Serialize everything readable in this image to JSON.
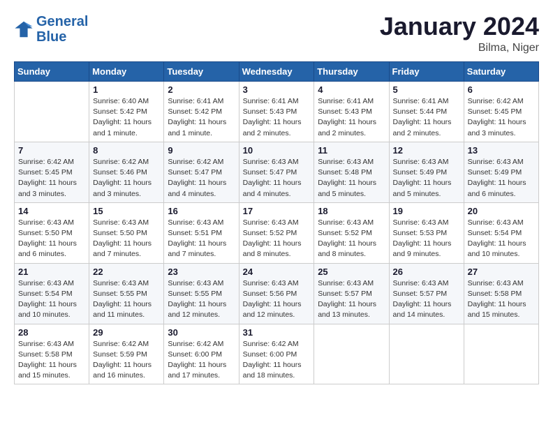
{
  "header": {
    "logo_line1": "General",
    "logo_line2": "Blue",
    "title": "January 2024",
    "subtitle": "Bilma, Niger"
  },
  "weekdays": [
    "Sunday",
    "Monday",
    "Tuesday",
    "Wednesday",
    "Thursday",
    "Friday",
    "Saturday"
  ],
  "weeks": [
    [
      {
        "day": "",
        "info": ""
      },
      {
        "day": "1",
        "info": "Sunrise: 6:40 AM\nSunset: 5:42 PM\nDaylight: 11 hours\nand 1 minute."
      },
      {
        "day": "2",
        "info": "Sunrise: 6:41 AM\nSunset: 5:42 PM\nDaylight: 11 hours\nand 1 minute."
      },
      {
        "day": "3",
        "info": "Sunrise: 6:41 AM\nSunset: 5:43 PM\nDaylight: 11 hours\nand 2 minutes."
      },
      {
        "day": "4",
        "info": "Sunrise: 6:41 AM\nSunset: 5:43 PM\nDaylight: 11 hours\nand 2 minutes."
      },
      {
        "day": "5",
        "info": "Sunrise: 6:41 AM\nSunset: 5:44 PM\nDaylight: 11 hours\nand 2 minutes."
      },
      {
        "day": "6",
        "info": "Sunrise: 6:42 AM\nSunset: 5:45 PM\nDaylight: 11 hours\nand 3 minutes."
      }
    ],
    [
      {
        "day": "7",
        "info": "Sunrise: 6:42 AM\nSunset: 5:45 PM\nDaylight: 11 hours\nand 3 minutes."
      },
      {
        "day": "8",
        "info": "Sunrise: 6:42 AM\nSunset: 5:46 PM\nDaylight: 11 hours\nand 3 minutes."
      },
      {
        "day": "9",
        "info": "Sunrise: 6:42 AM\nSunset: 5:47 PM\nDaylight: 11 hours\nand 4 minutes."
      },
      {
        "day": "10",
        "info": "Sunrise: 6:43 AM\nSunset: 5:47 PM\nDaylight: 11 hours\nand 4 minutes."
      },
      {
        "day": "11",
        "info": "Sunrise: 6:43 AM\nSunset: 5:48 PM\nDaylight: 11 hours\nand 5 minutes."
      },
      {
        "day": "12",
        "info": "Sunrise: 6:43 AM\nSunset: 5:49 PM\nDaylight: 11 hours\nand 5 minutes."
      },
      {
        "day": "13",
        "info": "Sunrise: 6:43 AM\nSunset: 5:49 PM\nDaylight: 11 hours\nand 6 minutes."
      }
    ],
    [
      {
        "day": "14",
        "info": "Sunrise: 6:43 AM\nSunset: 5:50 PM\nDaylight: 11 hours\nand 6 minutes."
      },
      {
        "day": "15",
        "info": "Sunrise: 6:43 AM\nSunset: 5:50 PM\nDaylight: 11 hours\nand 7 minutes."
      },
      {
        "day": "16",
        "info": "Sunrise: 6:43 AM\nSunset: 5:51 PM\nDaylight: 11 hours\nand 7 minutes."
      },
      {
        "day": "17",
        "info": "Sunrise: 6:43 AM\nSunset: 5:52 PM\nDaylight: 11 hours\nand 8 minutes."
      },
      {
        "day": "18",
        "info": "Sunrise: 6:43 AM\nSunset: 5:52 PM\nDaylight: 11 hours\nand 8 minutes."
      },
      {
        "day": "19",
        "info": "Sunrise: 6:43 AM\nSunset: 5:53 PM\nDaylight: 11 hours\nand 9 minutes."
      },
      {
        "day": "20",
        "info": "Sunrise: 6:43 AM\nSunset: 5:54 PM\nDaylight: 11 hours\nand 10 minutes."
      }
    ],
    [
      {
        "day": "21",
        "info": "Sunrise: 6:43 AM\nSunset: 5:54 PM\nDaylight: 11 hours\nand 10 minutes."
      },
      {
        "day": "22",
        "info": "Sunrise: 6:43 AM\nSunset: 5:55 PM\nDaylight: 11 hours\nand 11 minutes."
      },
      {
        "day": "23",
        "info": "Sunrise: 6:43 AM\nSunset: 5:55 PM\nDaylight: 11 hours\nand 12 minutes."
      },
      {
        "day": "24",
        "info": "Sunrise: 6:43 AM\nSunset: 5:56 PM\nDaylight: 11 hours\nand 12 minutes."
      },
      {
        "day": "25",
        "info": "Sunrise: 6:43 AM\nSunset: 5:57 PM\nDaylight: 11 hours\nand 13 minutes."
      },
      {
        "day": "26",
        "info": "Sunrise: 6:43 AM\nSunset: 5:57 PM\nDaylight: 11 hours\nand 14 minutes."
      },
      {
        "day": "27",
        "info": "Sunrise: 6:43 AM\nSunset: 5:58 PM\nDaylight: 11 hours\nand 15 minutes."
      }
    ],
    [
      {
        "day": "28",
        "info": "Sunrise: 6:43 AM\nSunset: 5:58 PM\nDaylight: 11 hours\nand 15 minutes."
      },
      {
        "day": "29",
        "info": "Sunrise: 6:42 AM\nSunset: 5:59 PM\nDaylight: 11 hours\nand 16 minutes."
      },
      {
        "day": "30",
        "info": "Sunrise: 6:42 AM\nSunset: 6:00 PM\nDaylight: 11 hours\nand 17 minutes."
      },
      {
        "day": "31",
        "info": "Sunrise: 6:42 AM\nSunset: 6:00 PM\nDaylight: 11 hours\nand 18 minutes."
      },
      {
        "day": "",
        "info": ""
      },
      {
        "day": "",
        "info": ""
      },
      {
        "day": "",
        "info": ""
      }
    ]
  ]
}
